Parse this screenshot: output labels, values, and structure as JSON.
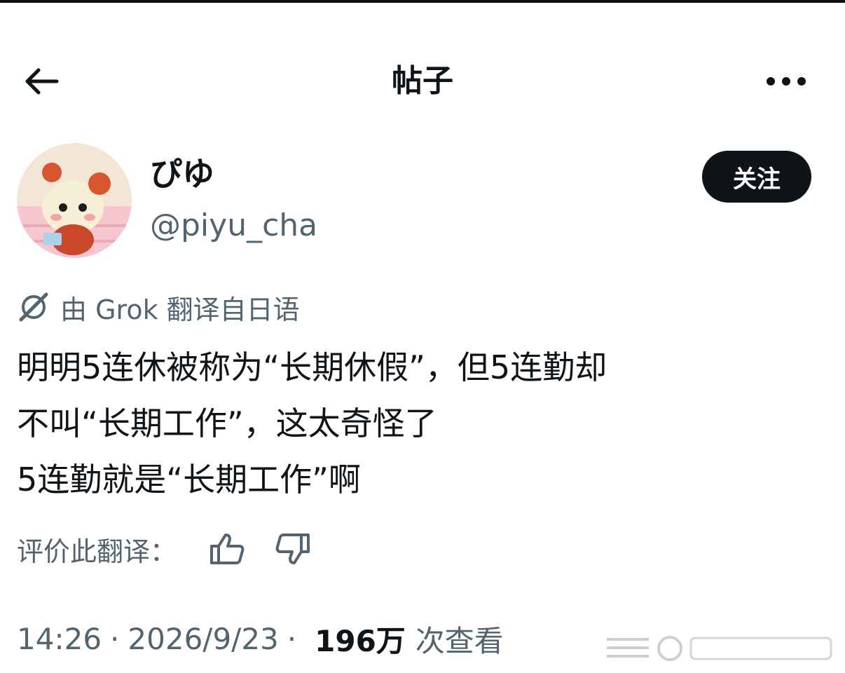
{
  "header": {
    "title": "帖子",
    "back_icon": "arrow-left-icon",
    "more_icon": "more-horizontal-icon"
  },
  "author": {
    "display_name": "ぴゆ",
    "handle": "@piyu_cha",
    "follow_label": "关注"
  },
  "translation": {
    "label": "由 Grok 翻译自日语",
    "icon": "grok-icon"
  },
  "post": {
    "lines": [
      "明明5连休被称为“长期休假”，但5连勤却",
      "不叫“长期工作”，这太奇怪了",
      "5连勤就是“长期工作”啊"
    ]
  },
  "rating": {
    "label": "评价此翻译：",
    "thumb_up_icon": "thumb-up-icon",
    "thumb_down_icon": "thumb-down-icon"
  },
  "meta": {
    "time": "14:26",
    "separator": "·",
    "date": "2026/9/23",
    "views_count": "196万",
    "views_label": "次查看"
  },
  "colors": {
    "text_primary": "#0f1419",
    "text_secondary": "#536471",
    "follow_bg": "#0f1419",
    "follow_text": "#ffffff"
  }
}
